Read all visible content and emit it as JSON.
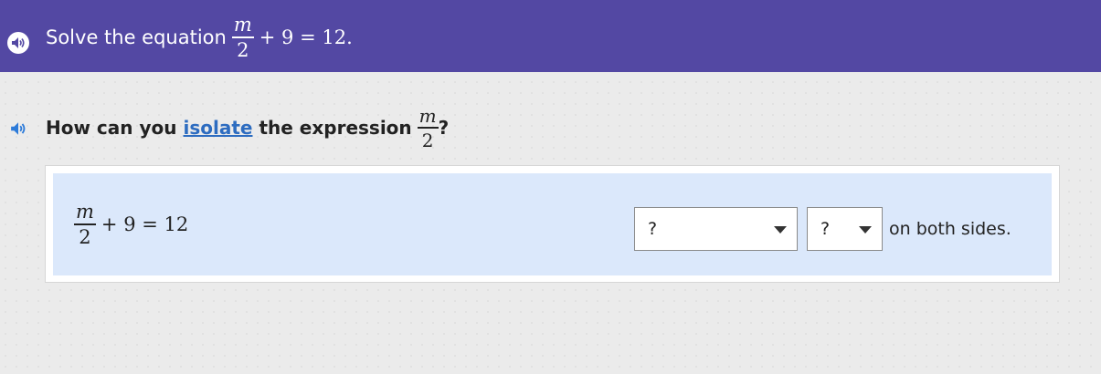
{
  "header": {
    "prompt": "Solve the equation",
    "equation": {
      "numerator": "m",
      "denominator": "2",
      "rest": "+ 9 = 12."
    }
  },
  "question": {
    "before": "How can you",
    "link": "isolate",
    "after": "the expression",
    "expr_num": "m",
    "expr_den": "2",
    "end": "?"
  },
  "work": {
    "equation": {
      "numerator": "m",
      "denominator": "2",
      "rest": "+ 9 = 12"
    },
    "operation_select": "?",
    "value_select": "?",
    "suffix": "on both sides."
  },
  "colors": {
    "header_bg": "#5348a3",
    "link": "#2d6cc0",
    "panel": "#dbe8fb"
  },
  "icons": {
    "audio": "speaker-icon"
  }
}
